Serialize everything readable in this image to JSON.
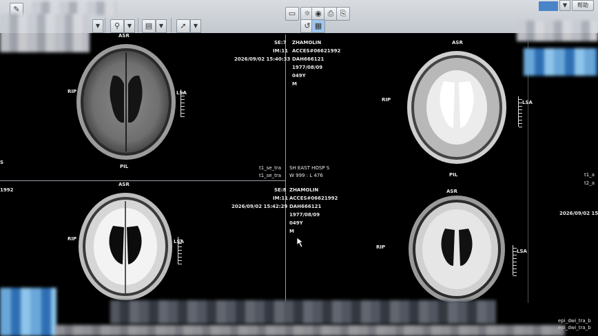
{
  "toolbar": {
    "top_right_value": "",
    "top_right_label": "帮助"
  },
  "viewports": [
    {
      "id": "top-left",
      "orient_top": "ASR",
      "orient_left": "RIP",
      "orient_right": "LSA",
      "orient_bottom": "PIL",
      "series": "SE:7",
      "image": "IM:11",
      "datetime": "2026/09/02 15:40:33",
      "seq1": "t1_se_tra",
      "seq2": "t1_se_tra",
      "left_edge": "S"
    },
    {
      "id": "bottom-left",
      "orient_top": "ASR",
      "orient_left": "RIP",
      "orient_right": "LSA",
      "series": "SE:8",
      "image": "IM:11",
      "datetime": "2026/09/02 15:42:29",
      "left_edge": "1992"
    },
    {
      "id": "top-right",
      "orient_top": "ASR",
      "orient_left": "RIP",
      "orient_right": "LSA",
      "orient_bottom": "PIL",
      "seq1": "t1_a",
      "seq2": "t2_a"
    },
    {
      "id": "bottom-right",
      "orient_top": "ASR",
      "orient_left": "RIP",
      "orient_right": "LSA",
      "datetime": "2026/09/02 15:",
      "seq1": "epi_dwi_tra_b",
      "seq2": "epi_dwi_tra_b"
    }
  ],
  "patient_top": {
    "name": "ZHAMOLIN",
    "accession": "ACCES#06621992",
    "id": "DAH666121",
    "dob": "1977/08/09",
    "age": "049Y",
    "sex": "M"
  },
  "patient_bottom": {
    "name": "ZHAMOLIN",
    "accession": "ACCES#06621992",
    "id": "DAH666121",
    "dob": "1977/08/09",
    "age": "049Y",
    "sex": "M"
  },
  "hospital": "SH EAST HOSP S",
  "window_level": "W 999 : L 476",
  "colors": {
    "toolbar": "#c8cdd3",
    "viewport_bg": "#000000",
    "text": "#eaeaea",
    "accent": "#4a84c8"
  },
  "icons": [
    "pencil-icon",
    "stamp-icon",
    "document-icon",
    "arrow-icon",
    "folder-icon",
    "lightbulb-icon",
    "camera-icon",
    "print-icon",
    "rotate-icon",
    "grid-icon"
  ]
}
